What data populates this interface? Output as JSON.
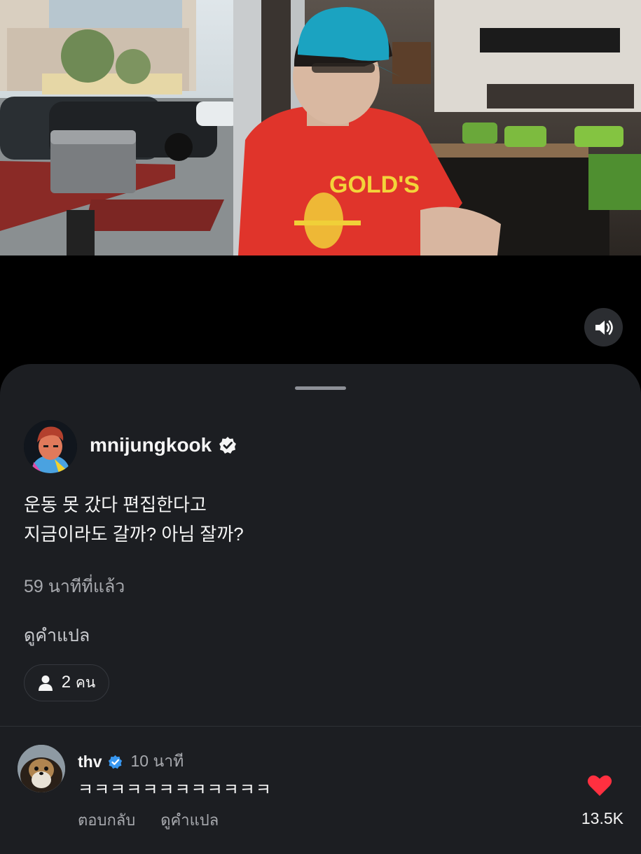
{
  "post": {
    "username": "mnijungkook",
    "verified_icon": "verified-badge-icon",
    "caption_lines": [
      "운동 못 갔다 편집한다고",
      "지금이라도 갈까? 아님 잘까?"
    ],
    "time_ago": "59 นาทีที่แล้ว",
    "see_translation": "ดูคำแปล",
    "viewers_count": "2",
    "viewers_unit": "คน"
  },
  "video": {
    "shirt_text": "GOLD'S",
    "mute_icon": "speaker-icon"
  },
  "comment": {
    "username": "thv",
    "time": "10 นาที",
    "text": "ㅋㅋㅋㅋㅋㅋㅋㅋㅋㅋㅋㅋ",
    "reply_label": "ตอบกลับ",
    "translate_label": "ดูคำแปล",
    "like_count": "13.5K",
    "like_color": "#ff3040",
    "verified_color": "#3897f0"
  }
}
